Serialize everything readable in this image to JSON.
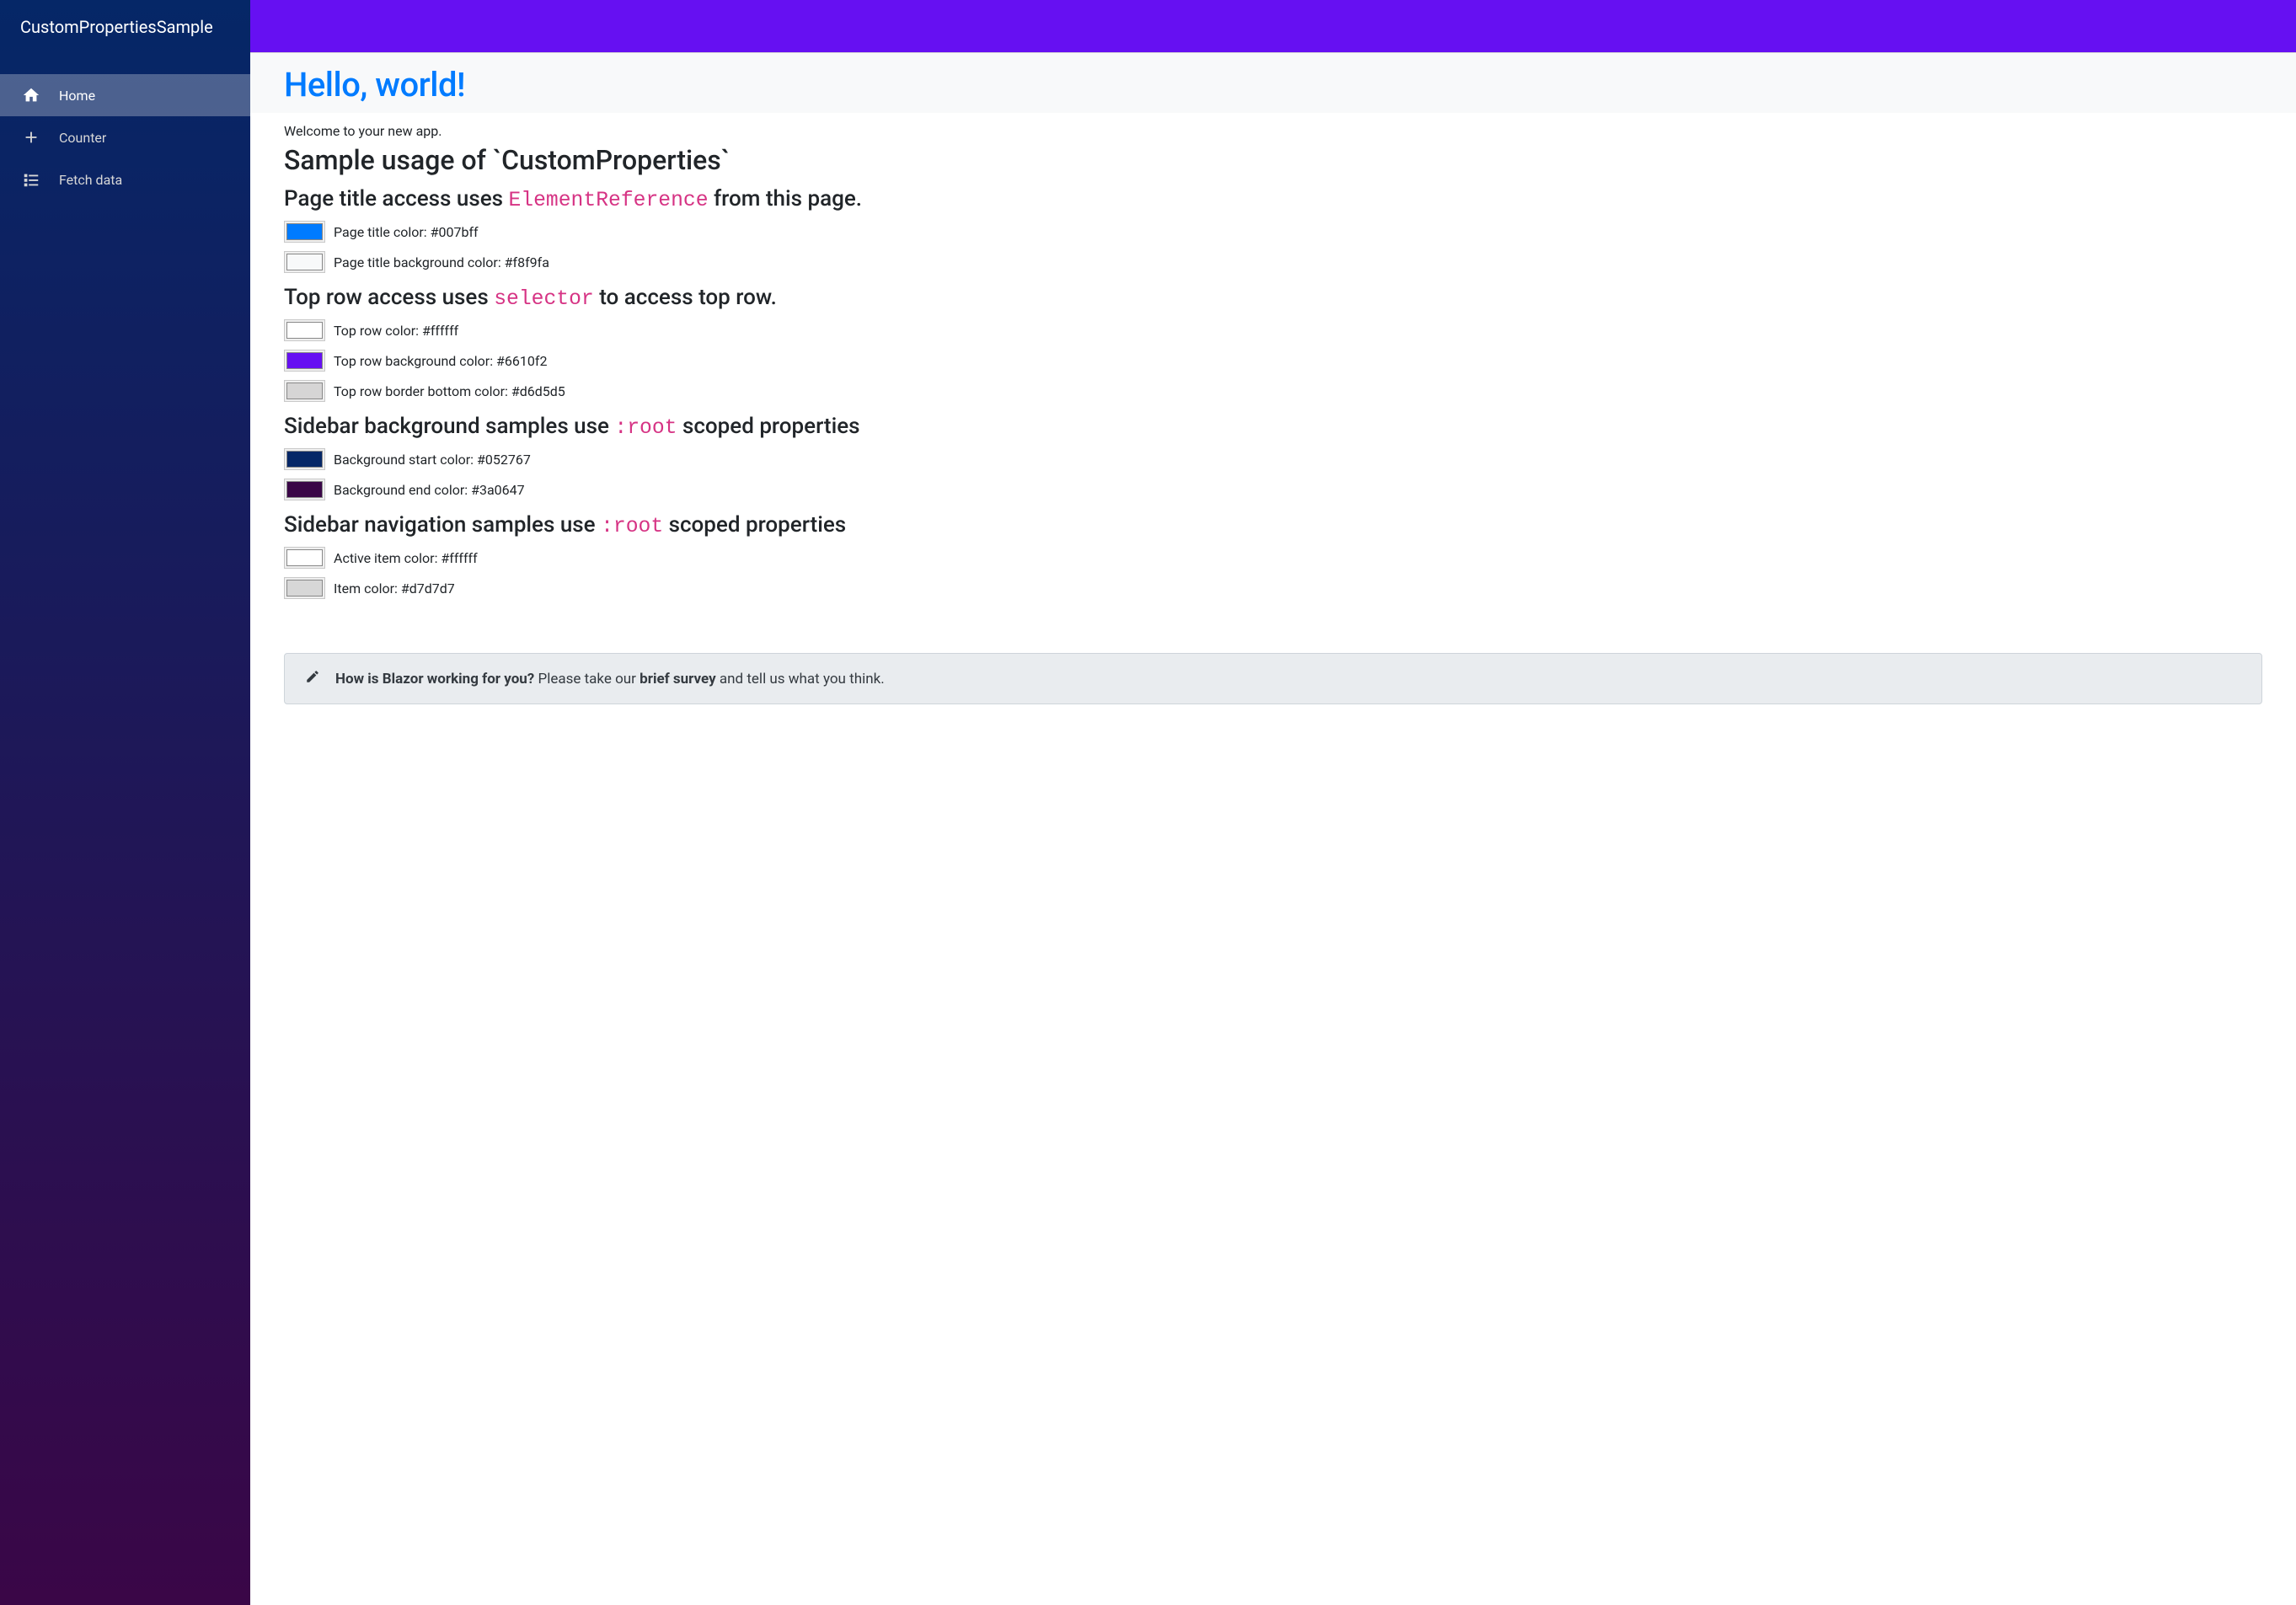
{
  "sidebar": {
    "brand": "CustomPropertiesSample",
    "items": [
      {
        "label": "Home",
        "icon": "home-icon",
        "active": true
      },
      {
        "label": "Counter",
        "icon": "plus-icon",
        "active": false
      },
      {
        "label": "Fetch data",
        "icon": "list-icon",
        "active": false
      }
    ]
  },
  "top_row": {
    "color": "#ffffff",
    "background": "#6610f2",
    "border_bottom": "#d6d5d5"
  },
  "page": {
    "title": "Hello, world!",
    "title_color": "#007bff",
    "title_bg": "#f8f9fa",
    "welcome": "Welcome to your new app.",
    "heading": "Sample usage of `CustomProperties`"
  },
  "sections": [
    {
      "heading_pre": "Page title access uses ",
      "heading_code": "ElementReference",
      "heading_post": " from this page.",
      "props": [
        {
          "label": "Page title color: #007bff",
          "color": "#007bff"
        },
        {
          "label": "Page title background color: #f8f9fa",
          "color": "#f8f9fa"
        }
      ]
    },
    {
      "heading_pre": "Top row access uses ",
      "heading_code": "selector",
      "heading_post": " to access top row.",
      "props": [
        {
          "label": "Top row color: #ffffff",
          "color": "#ffffff"
        },
        {
          "label": "Top row background color: #6610f2",
          "color": "#6610f2"
        },
        {
          "label": "Top row border bottom color: #d6d5d5",
          "color": "#d6d5d5"
        }
      ]
    },
    {
      "heading_pre": "Sidebar background samples use ",
      "heading_code": ":root",
      "heading_post": " scoped properties",
      "props": [
        {
          "label": "Background start color: #052767",
          "color": "#052767"
        },
        {
          "label": "Background end color: #3a0647",
          "color": "#3a0647"
        }
      ]
    },
    {
      "heading_pre": "Sidebar navigation samples use ",
      "heading_code": ":root",
      "heading_post": " scoped properties",
      "props": [
        {
          "label": "Active item color: #ffffff",
          "color": "#ffffff"
        },
        {
          "label": "Item color: #d7d7d7",
          "color": "#d7d7d7"
        }
      ]
    }
  ],
  "survey": {
    "question": "How is Blazor working for you?",
    "mid": " Please take our ",
    "link": "brief survey",
    "rest": " and tell us what you think."
  }
}
